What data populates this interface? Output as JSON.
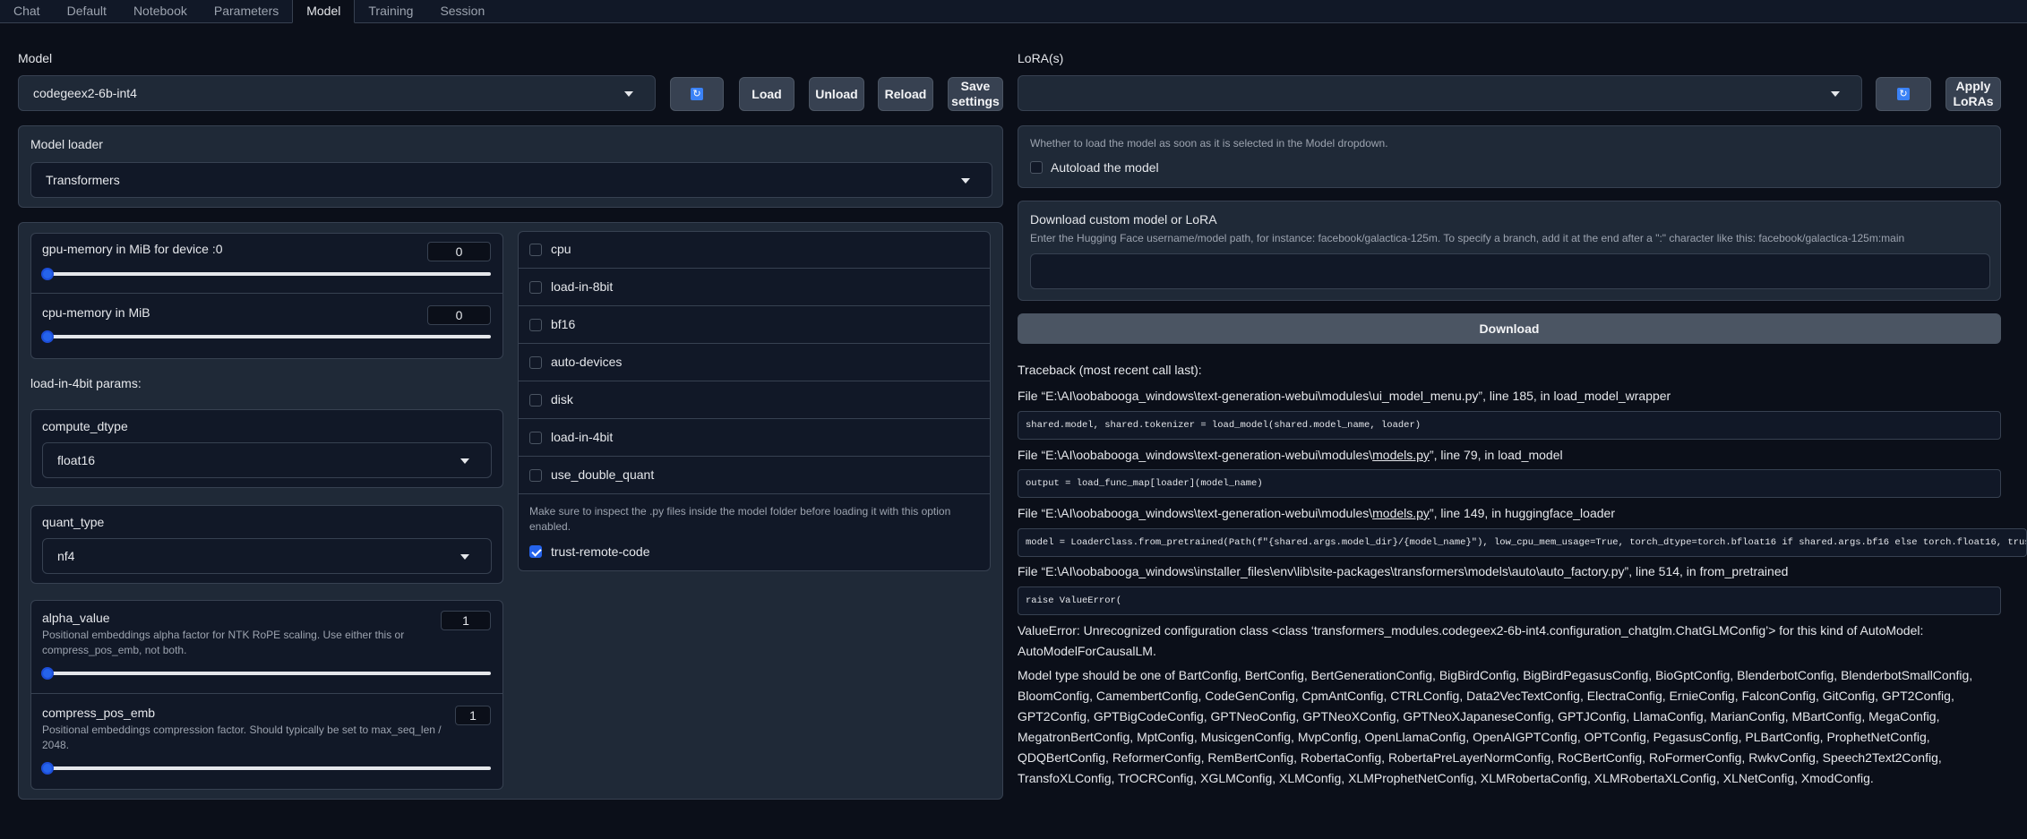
{
  "tabs": [
    "Chat",
    "Default",
    "Notebook",
    "Parameters",
    "Model",
    "Training",
    "Session"
  ],
  "active_tab": "Model",
  "model": {
    "label": "Model",
    "selected": "codegeex2-6b-int4",
    "load": "Load",
    "unload": "Unload",
    "reload": "Reload",
    "save_line1": "Save",
    "save_line2": "settings"
  },
  "lora": {
    "label": "LoRA(s)",
    "selected": "",
    "apply_line1": "Apply",
    "apply_line2": "LoRAs"
  },
  "loader": {
    "label": "Model loader",
    "selected": "Transformers"
  },
  "gpu_memory": {
    "label": "gpu-memory in MiB for device :0",
    "value": "0",
    "level": 0
  },
  "cpu_memory": {
    "label": "cpu-memory in MiB",
    "value": "0",
    "level": 0
  },
  "params_4bit_label": "load-in-4bit params:",
  "compute_dtype": {
    "label": "compute_dtype",
    "selected": "float16"
  },
  "quant_type": {
    "label": "quant_type",
    "selected": "nf4"
  },
  "alpha_value": {
    "label": "alpha_value",
    "desc_line1": "Positional embeddings alpha factor for NTK RoPE scaling. Use either this or",
    "desc_line2": "compress_pos_emb, not both.",
    "value": "1",
    "level": 0
  },
  "compress_pos_emb": {
    "label": "compress_pos_emb",
    "desc_line1": "Positional embeddings compression factor. Should typically be set to max_seq_len /",
    "desc_line2": "2048.",
    "value": "1",
    "level": 0
  },
  "checkboxes": [
    {
      "label": "cpu",
      "checked": false
    },
    {
      "label": "load-in-8bit",
      "checked": false
    },
    {
      "label": "bf16",
      "checked": false
    },
    {
      "label": "auto-devices",
      "checked": false
    },
    {
      "label": "disk",
      "checked": false
    },
    {
      "label": "load-in-4bit",
      "checked": false
    },
    {
      "label": "use_double_quant",
      "checked": false
    }
  ],
  "trust_remote": {
    "info_line1": "Make sure to inspect the .py files inside the model folder before loading it with this option",
    "info_line2": "enabled.",
    "label": "trust-remote-code",
    "checked": true
  },
  "autoload": {
    "info": "Whether to load the model as soon as it is selected in the Model dropdown.",
    "label": "Autoload the model"
  },
  "download": {
    "title": "Download custom model or LoRA",
    "info": "Enter the Hugging Face username/model path, for instance: facebook/galactica-125m. To specify a branch, add it at the end after a \":\" character like this: facebook/galactica-125m:main",
    "value": "",
    "button": "Download"
  },
  "traceback": {
    "header": "Traceback (most recent call last):",
    "f1_pre": "File “E:\\AI\\oobabooga_windows\\text-generation-webui\\modules\\ui_model_menu.py”, line 185, in load_model_wrapper",
    "c1": "shared.model, shared.tokenizer = load_model(shared.model_name, loader)",
    "f2_pre": "File “E:\\AI\\oobabooga_windows\\text-generation-webui\\modules\\",
    "f2_link": "models.py",
    "f2_post": "”, line 79, in load_model",
    "c2": "output = load_func_map[loader](model_name)",
    "f3_pre": "File “E:\\AI\\oobabooga_windows\\text-generation-webui\\modules\\",
    "f3_link": "models.py",
    "f3_post": "”, line 149, in huggingface_loader",
    "c3": "model = LoaderClass.from_pretrained(Path(f\"{shared.args.model_dir}/{model_name}\"), low_cpu_mem_usage=True, torch_dtype=torch.bfloat16 if shared.args.bf16 else torch.float16, trust_remote_code=shared.args.trust_remote_code)",
    "f4_pre": "File “E:\\AI\\oobabooga_windows\\installer_files\\env\\lib\\site-packages\\transformers\\models\\auto\\auto_factory.py”, line 514, in from_pretrained",
    "c4": "raise ValueError(",
    "error": "ValueError: Unrecognized configuration class <class ‘transformers_modules.codegeex2-6b-int4.configuration_chatglm.ChatGLMConfig’> for this kind of AutoModel: AutoModelForCausalLM.",
    "model_types": "Model type should be one of BartConfig, BertConfig, BertGenerationConfig, BigBirdConfig, BigBirdPegasusConfig, BioGptConfig, BlenderbotConfig, BlenderbotSmallConfig, BloomConfig, CamembertConfig, CodeGenConfig, CpmAntConfig, CTRLConfig, Data2VecTextConfig, ElectraConfig, ErnieConfig, FalconConfig, GitConfig, GPT2Config, GPT2Config, GPTBigCodeConfig, GPTNeoConfig, GPTNeoXConfig, GPTNeoXJapaneseConfig, GPTJConfig, LlamaConfig, MarianConfig, MBartConfig, MegaConfig, MegatronBertConfig, MptConfig, MusicgenConfig, MvpConfig, OpenLlamaConfig, OpenAIGPTConfig, OPTConfig, PegasusConfig, PLBartConfig, ProphetNetConfig, QDQBertConfig, ReformerConfig, RemBertConfig, RobertaConfig, RobertaPreLayerNormConfig, RoCBertConfig, RoFormerConfig, RwkvConfig, Speech2Text2Config, TransfoXLConfig, TrOCRConfig, XGLMConfig, XLMConfig, XLMProphetNetConfig, XLMRobertaConfig, XLMRobertaXLConfig, XLNetConfig, XmodConfig."
  },
  "colors": {
    "accent": "#2563eb",
    "background": "#0b0f19",
    "panel": "#1f2937"
  },
  "icons": {
    "refresh": "refresh-icon",
    "dropdown": "chevron-down-icon"
  }
}
